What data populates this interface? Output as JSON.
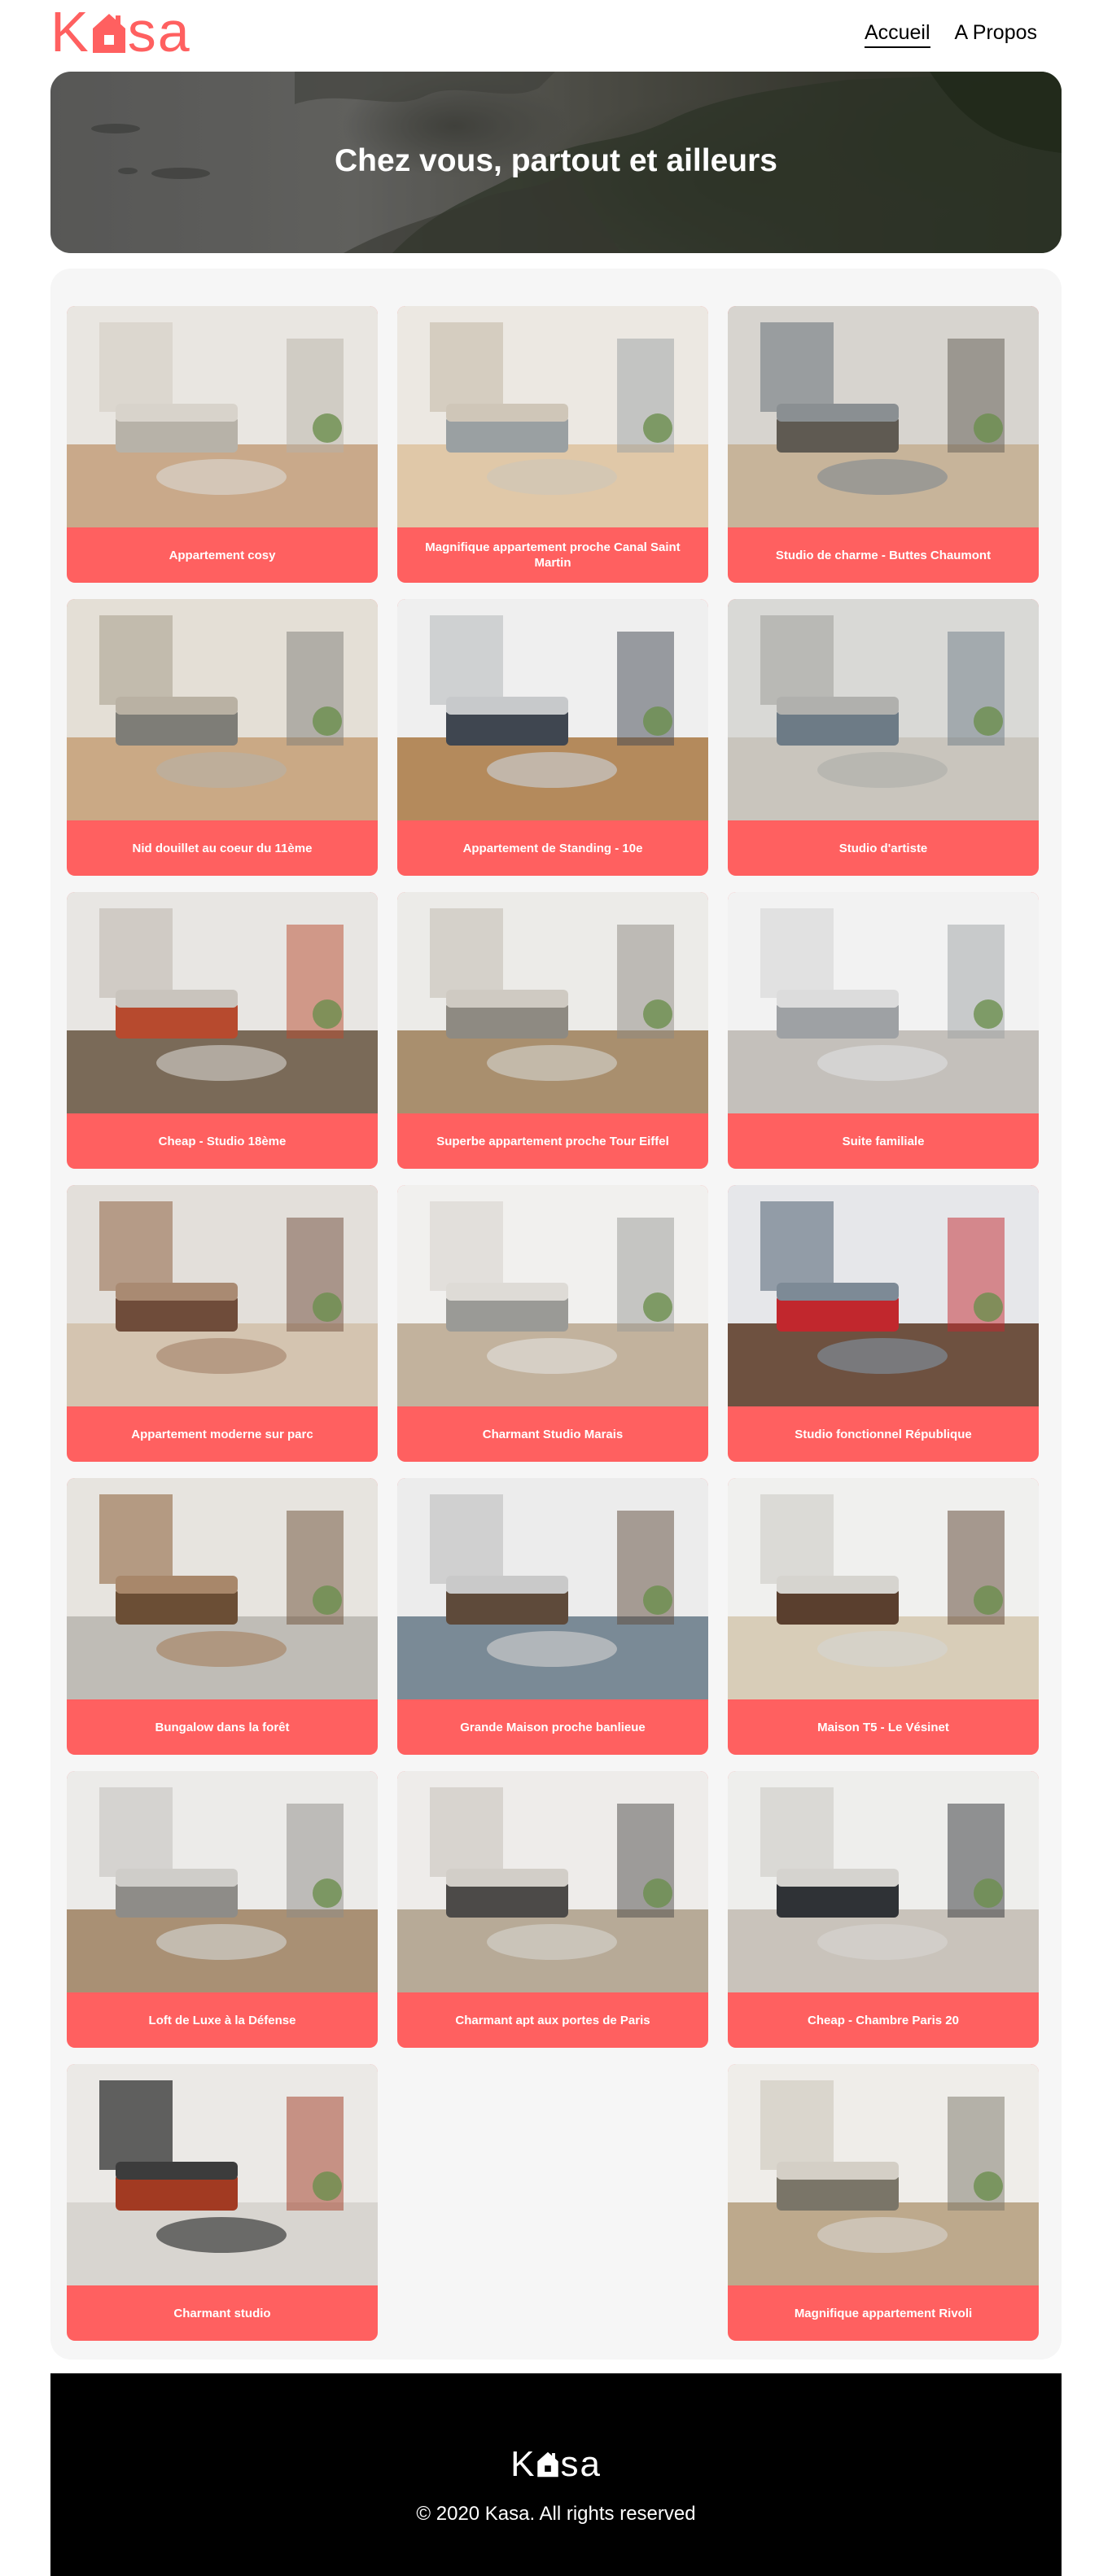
{
  "header": {
    "logo_left": "K",
    "logo_right": "sa",
    "nav": [
      {
        "label": "Accueil"
      },
      {
        "label": "A Propos"
      }
    ]
  },
  "banner": {
    "title": "Chez vous, partout et ailleurs"
  },
  "listings": [
    {
      "title": "Appartement cosy"
    },
    {
      "title": "Magnifique appartement proche Canal Saint Martin"
    },
    {
      "title": "Studio de charme - Buttes Chaumont"
    },
    {
      "title": "Nid douillet au coeur du 11ème"
    },
    {
      "title": "Appartement de Standing - 10e"
    },
    {
      "title": "Studio d'artiste"
    },
    {
      "title": "Cheap - Studio 18ème"
    },
    {
      "title": "Superbe appartement proche Tour Eiffel"
    },
    {
      "title": "Suite familiale"
    },
    {
      "title": "Appartement moderne sur parc"
    },
    {
      "title": "Charmant Studio Marais"
    },
    {
      "title": "Studio fonctionnel République"
    },
    {
      "title": "Bungalow dans la forêt"
    },
    {
      "title": "Grande Maison proche banlieue"
    },
    {
      "title": "Maison T5 - Le Vésinet"
    },
    {
      "title": "Loft de Luxe à la Défense"
    },
    {
      "title": "Charmant apt aux portes de Paris"
    },
    {
      "title": "Cheap - Chambre Paris 20"
    },
    {
      "title": "Charmant studio"
    },
    {
      "title": "Magnifique appartement Rivoli"
    }
  ],
  "footer": {
    "logo_left": "K",
    "logo_right": "sa",
    "copyright": "© 2020 Kasa. All rights reserved"
  },
  "colors": {
    "brand": "#ff6060",
    "gallery_bg": "#f6f6f6",
    "footer_bg": "#000000"
  }
}
